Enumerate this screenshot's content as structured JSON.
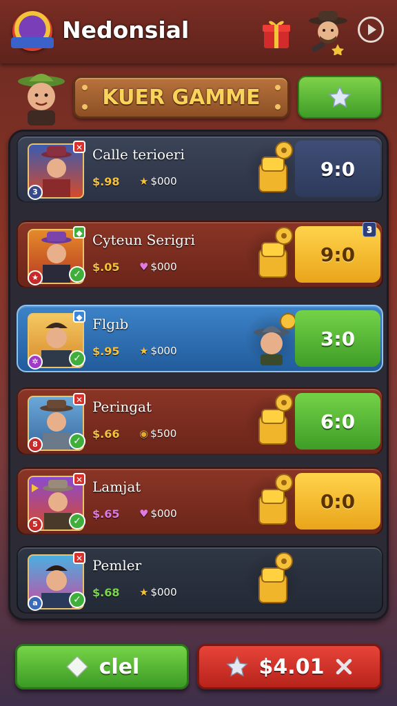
{
  "header": {
    "title": "Nedonsial",
    "logo_icon": "game-logo-icon",
    "gift_icon": "gift-box-icon",
    "avatar_icon": "cowboy-avatar-icon",
    "play_icon": "play-circle-icon"
  },
  "banner": {
    "label": "KUER GAMME",
    "star_icon": "star-icon"
  },
  "rows": [
    {
      "name": "Calle terioeri",
      "price": "$.98",
      "coin_icon": "gold-star-icon",
      "coins": "$000",
      "score": "9:0",
      "style": "dark",
      "reward_icon": "gold-gear-stack-icon",
      "tag": ""
    },
    {
      "name": "Cyteun Serigri",
      "price": "$.05",
      "coin_icon": "pink-heart-icon",
      "coins": "$000",
      "score": "9:0",
      "style": "yellow",
      "reward_icon": "gold-gear-stack-icon",
      "tag": "3"
    },
    {
      "name": "Flgıb",
      "price": "$.95",
      "coin_icon": "gold-star-icon",
      "coins": "$000",
      "score": "3:0",
      "style": "green",
      "reward_icon": "adventurer-avatar-icon",
      "tag": ""
    },
    {
      "name": "Peringat",
      "price": "$.66",
      "coin_icon": "gold-coin-icon",
      "coins": "$500",
      "score": "6:0",
      "style": "green",
      "reward_icon": "gold-gear-stack-icon",
      "tag": ""
    },
    {
      "name": "Lamjat",
      "price": "$.65",
      "coin_icon": "pink-heart-icon",
      "coins": "$000",
      "score": "0:0",
      "style": "yellow",
      "reward_icon": "gold-gear-stack-icon",
      "tag": ""
    },
    {
      "name": "Pemler",
      "price": "$.68",
      "coin_icon": "gold-star-icon",
      "coins": "$000",
      "score": "",
      "style": "none",
      "reward_icon": "gold-gear-stack-icon",
      "tag": ""
    }
  ],
  "footer": {
    "left_label": "clel",
    "left_icon": "diamond-icon",
    "right_label": "$4.01",
    "right_icon": "star-icon",
    "close_icon": "close-x-icon"
  },
  "colors": {
    "accent_green": "#4caf2e",
    "accent_red": "#d0302a",
    "accent_gold": "#f6c23c"
  }
}
